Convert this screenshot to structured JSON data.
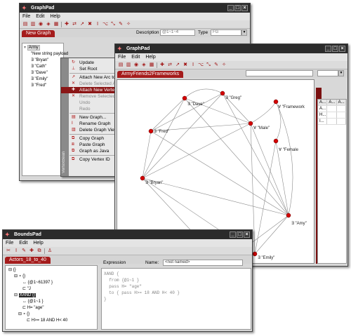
{
  "graphpad1": {
    "title": "GraphPad",
    "menu": [
      "File",
      "Edit",
      "Help"
    ],
    "tab": "New Graph",
    "description_label": "Description",
    "description_value": "@1~1~4",
    "type_label": "Type",
    "type_value": "FG",
    "tree": {
      "root": "Army",
      "items": [
        "\"New string payload",
        "∃ \"Bryan\"",
        "∃ \"Cath\"",
        "∃ \"Dave\"",
        "∃ \"Emily\"",
        "∃ \"Fred\""
      ]
    }
  },
  "context_menu": {
    "side_label": "VertexBean",
    "items": [
      {
        "label": "Update",
        "state": "normal"
      },
      {
        "label": "Set Root",
        "state": "normal"
      },
      {
        "label": "Attach New Arc to",
        "state": "normal"
      },
      {
        "label": "Delete Selected Arc",
        "state": "disabled"
      },
      {
        "label": "Attach New Vertex",
        "state": "highlight"
      },
      {
        "label": "Remove Selected Ve",
        "state": "disabled"
      },
      {
        "label": "Undo",
        "state": "disabled"
      },
      {
        "label": "Redo",
        "state": "disabled"
      },
      {
        "label": "New Graph...",
        "state": "normal"
      },
      {
        "label": "Rename Graph",
        "state": "normal"
      },
      {
        "label": "Delete Graph View",
        "state": "normal"
      },
      {
        "label": "Copy Graph",
        "state": "normal"
      },
      {
        "label": "Paste Graph",
        "state": "normal"
      },
      {
        "label": "Graph as Java",
        "state": "normal"
      },
      {
        "label": "Copy Vertex ID",
        "state": "normal"
      }
    ]
  },
  "graphpad2": {
    "title": "GraphPad",
    "menu": [
      "File",
      "Edit",
      "Help"
    ],
    "tab": "ArmyFriends2Frameworks",
    "nodes": [
      {
        "label": "∃ \"Dave\""
      },
      {
        "label": "∃ \"Greg\""
      },
      {
        "label": "∀ \"Framework"
      },
      {
        "label": "∃ \"Fred\""
      },
      {
        "label": "∀ \"Male\""
      },
      {
        "label": "∀ \"Female"
      },
      {
        "label": "∃ \"Bryan\""
      },
      {
        "label": "∃ \"Amy\""
      },
      {
        "label": "∃ \"Emily\""
      }
    ],
    "table": {
      "header": [
        "A...",
        "A...",
        "A..."
      ],
      "rows": [
        [
          "A...",
          "",
          ""
        ],
        [
          "H...",
          "",
          ""
        ],
        [
          "I...",
          "",
          ""
        ]
      ]
    }
  },
  "boundspad": {
    "title": "BoundsPad",
    "menu": [
      "File",
      "Edit",
      "Help"
    ],
    "tab": "Actors_18_to_40",
    "expression_label": "Expression",
    "name_label": "Name:",
    "name_value": "<not named>",
    "tree": [
      "{}",
      "{}",
      "{@1~61397 }",
      "\"J",
      "XAND {}",
      "{@1~1 }",
      "H= \"age\"",
      "{}",
      "H>= 18 AND H< 40"
    ],
    "expression_lines": [
      "XAND {",
      "  from {@1~1 }",
      "  pass H= \"age\"",
      "  to { pass H>= 18 AND H< 40 }",
      "}"
    ]
  }
}
